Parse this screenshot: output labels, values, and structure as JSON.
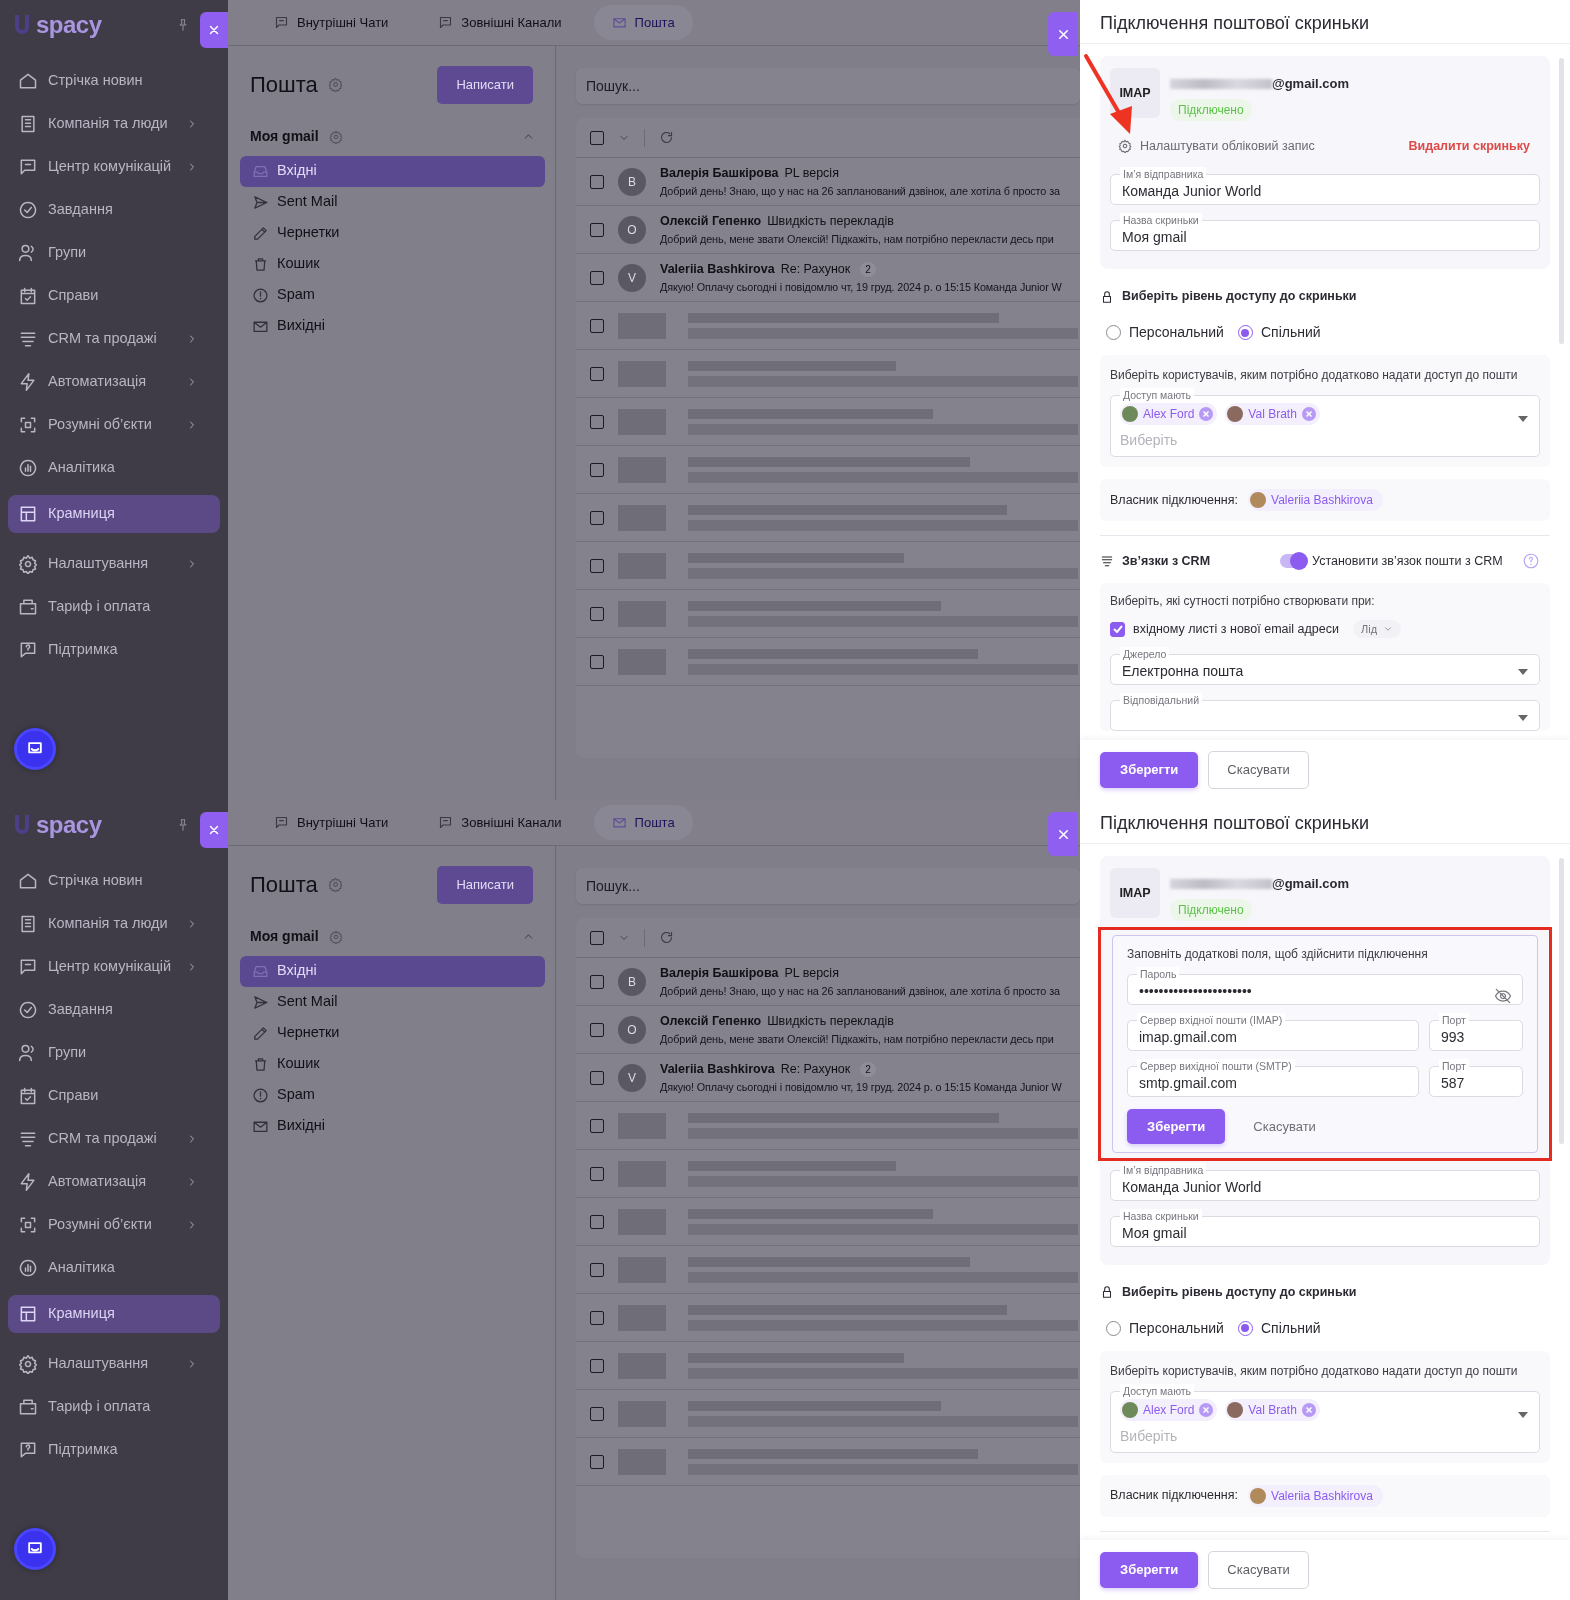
{
  "screens": [
    {
      "sidebar": {
        "logo": "spacy",
        "items": [
          {
            "label": "Стрічка новин",
            "submenu": false,
            "selected": false
          },
          {
            "label": "Компанія та люди",
            "submenu": true,
            "selected": false
          },
          {
            "label": "Центр комунікацій",
            "submenu": true,
            "selected": false
          },
          {
            "label": "Завдання",
            "submenu": false,
            "selected": false
          },
          {
            "label": "Групи",
            "submenu": false,
            "selected": false
          },
          {
            "label": "Справи",
            "submenu": false,
            "selected": false
          },
          {
            "label": "CRM та продажі",
            "submenu": true,
            "selected": false
          },
          {
            "label": "Автоматизація",
            "submenu": true,
            "selected": false
          },
          {
            "label": "Розумні об’єкти",
            "submenu": true,
            "selected": false
          },
          {
            "label": "Аналітика",
            "submenu": false,
            "selected": false
          },
          {
            "label": "Крамниця",
            "submenu": false,
            "selected": true
          },
          {
            "label": "Налаштування",
            "submenu": true,
            "selected": false
          },
          {
            "label": "Тариф і оплата",
            "submenu": false,
            "selected": false
          },
          {
            "label": "Підтримка",
            "submenu": false,
            "selected": false
          }
        ]
      },
      "tabs": [
        {
          "label": "Внутрішні Чати",
          "selected": false
        },
        {
          "label": "Зовнішні Канали",
          "selected": false
        },
        {
          "label": "Пошта",
          "selected": true
        }
      ],
      "mail": {
        "title": "Пошта",
        "compose": "Написати",
        "account": {
          "name": "Моя gmail",
          "expanded": true
        },
        "folders": [
          {
            "label": "Вхідні",
            "selected": true
          },
          {
            "label": "Sent Mail",
            "selected": false
          },
          {
            "label": "Чернетки",
            "selected": false
          },
          {
            "label": "Кошик",
            "selected": false
          },
          {
            "label": "Spam",
            "selected": false
          },
          {
            "label": "Вихідні",
            "selected": false
          }
        ],
        "search": {
          "placeholder": "Пошук..."
        },
        "select_all": {
          "checked": false
        },
        "messages": [
          {
            "kind": "message",
            "checked": false,
            "avatar": "В",
            "sender": "Валерія Башкірова",
            "subject": "PL версія",
            "preview": "Добрий день! Знаю, що у нас на 26 запланований дзвінок, але хотіла б просто за"
          },
          {
            "kind": "message",
            "checked": false,
            "avatar": "О",
            "sender": "Олексій Гепенко",
            "subject": "Швидкість перекладів",
            "preview": "Добрий день, мене звати Олексій! Підкажіть, нам потрібно перекласти десь при"
          },
          {
            "kind": "message",
            "checked": false,
            "avatar": "V",
            "sender": "Valeriia Bashkirova",
            "subject": "Re: Рахунок",
            "count": "2",
            "preview": "Дякую! Оплачу сьогодні і повідомлю чт, 19 груд. 2024 р. о 15:15 Команда Junior W"
          },
          {
            "kind": "blurred",
            "checked": false
          },
          {
            "kind": "blurred",
            "checked": false
          },
          {
            "kind": "blurred",
            "checked": false
          },
          {
            "kind": "blurred",
            "checked": false
          },
          {
            "kind": "blurred",
            "checked": false
          },
          {
            "kind": "blurred",
            "checked": false
          },
          {
            "kind": "blurred",
            "checked": false
          },
          {
            "kind": "blurred",
            "checked": false
          }
        ]
      },
      "panel": {
        "title": "Підключення поштової скриньки",
        "arrow": true,
        "account": {
          "protocol": "IMAP",
          "email": "@gmail.com",
          "status": "Підключено",
          "settings_link": "Налаштувати обліковий запис",
          "delete_link": "Видалити скриньку"
        },
        "fields": [
          {
            "label": "Ім’я відправника",
            "value": "Команда Junior World"
          },
          {
            "label": "Назва скриньки",
            "value": "Моя gmail"
          }
        ],
        "access": {
          "title": "Виберіть рівень доступу до скриньки",
          "options": [
            {
              "label": "Персональний",
              "selected": false
            },
            {
              "label": "Спільний",
              "selected": true
            }
          ]
        },
        "users": {
          "hint": "Виберіть користувачів, яким потрібно додатково надати доступ до пошти",
          "label": "Доступ мають",
          "chips": [
            "Alex Ford",
            "Val Brath"
          ],
          "placeholder": "Виберіть"
        },
        "owner": {
          "label": "Власник підключення:",
          "name": "Valeriia Bashkirova"
        },
        "crm": {
          "title": "Зв’язки з CRM",
          "toggle": {
            "label": "Установити зв’язок пошти з CRM",
            "on": true
          },
          "hint": "Виберіть, які сутності потрібно створювати при:",
          "rule": {
            "label": "вхідному листі з нової email адреси",
            "checked": true,
            "entity": "Лід"
          },
          "fields": [
            {
              "label": "Джерело",
              "value": "Електронна пошта"
            },
            {
              "label": "Відповідальний"
            }
          ]
        },
        "footer": {
          "save": "Зберегти",
          "cancel": "Скасувати"
        }
      }
    },
    {
      "sidebar": {
        "logo": "spacy",
        "items": [
          {
            "label": "Стрічка новин",
            "submenu": false,
            "selected": false
          },
          {
            "label": "Компанія та люди",
            "submenu": true,
            "selected": false
          },
          {
            "label": "Центр комунікацій",
            "submenu": true,
            "selected": false
          },
          {
            "label": "Завдання",
            "submenu": false,
            "selected": false
          },
          {
            "label": "Групи",
            "submenu": false,
            "selected": false
          },
          {
            "label": "Справи",
            "submenu": false,
            "selected": false
          },
          {
            "label": "CRM та продажі",
            "submenu": true,
            "selected": false
          },
          {
            "label": "Автоматизація",
            "submenu": true,
            "selected": false
          },
          {
            "label": "Розумні об’єкти",
            "submenu": true,
            "selected": false
          },
          {
            "label": "Аналітика",
            "submenu": false,
            "selected": false
          },
          {
            "label": "Крамниця",
            "submenu": false,
            "selected": true
          },
          {
            "label": "Налаштування",
            "submenu": true,
            "selected": false
          },
          {
            "label": "Тариф і оплата",
            "submenu": false,
            "selected": false
          },
          {
            "label": "Підтримка",
            "submenu": false,
            "selected": false
          }
        ]
      },
      "tabs": [
        {
          "label": "Внутрішні Чати",
          "selected": false
        },
        {
          "label": "Зовнішні Канали",
          "selected": false
        },
        {
          "label": "Пошта",
          "selected": true
        }
      ],
      "mail": {
        "title": "Пошта",
        "compose": "Написати",
        "account": {
          "name": "Моя gmail",
          "expanded": true
        },
        "folders": [
          {
            "label": "Вхідні",
            "selected": true
          },
          {
            "label": "Sent Mail",
            "selected": false
          },
          {
            "label": "Чернетки",
            "selected": false
          },
          {
            "label": "Кошик",
            "selected": false
          },
          {
            "label": "Spam",
            "selected": false
          },
          {
            "label": "Вихідні",
            "selected": false
          }
        ],
        "search": {
          "placeholder": "Пошук..."
        },
        "select_all": {
          "checked": false
        },
        "messages": [
          {
            "kind": "message",
            "checked": false,
            "avatar": "В",
            "sender": "Валерія Башкірова",
            "subject": "PL версія",
            "preview": "Добрий день! Знаю, що у нас на 26 запланований дзвінок, але хотіла б просто за"
          },
          {
            "kind": "message",
            "checked": false,
            "avatar": "О",
            "sender": "Олексій Гепенко",
            "subject": "Швидкість перекладів",
            "preview": "Добрий день, мене звати Олексій! Підкажіть, нам потрібно перекласти десь при"
          },
          {
            "kind": "message",
            "checked": false,
            "avatar": "V",
            "sender": "Valeriia Bashkirova",
            "subject": "Re: Рахунок",
            "count": "2",
            "preview": "Дякую! Оплачу сьогодні і повідомлю чт, 19 груд. 2024 р. о 15:15 Команда Junior W"
          },
          {
            "kind": "blurred",
            "checked": false
          },
          {
            "kind": "blurred",
            "checked": false
          },
          {
            "kind": "blurred",
            "checked": false
          },
          {
            "kind": "blurred",
            "checked": false
          },
          {
            "kind": "blurred",
            "checked": false
          },
          {
            "kind": "blurred",
            "checked": false
          },
          {
            "kind": "blurred",
            "checked": false
          },
          {
            "kind": "blurred",
            "checked": false
          }
        ]
      },
      "panel": {
        "title": "Підключення поштової скриньки",
        "frame": true,
        "account": {
          "protocol": "IMAP",
          "email": "@gmail.com",
          "status": "Підключено"
        },
        "connect_form": {
          "hint": "Заповніть додаткові поля, щоб здійснити підключення",
          "password": {
            "label": "Пароль",
            "value": "•••••••••••••••••••••••"
          },
          "servers": [
            {
              "label": "Сервер вхідної пошти (IMAP)",
              "value": "imap.gmail.com",
              "port_label": "Порт",
              "port": "993"
            },
            {
              "label": "Сервер вихідної пошти (SMTP)",
              "value": "smtp.gmail.com",
              "port_label": "Порт",
              "port": "587"
            }
          ],
          "save": "Зберегти",
          "cancel": "Скасувати"
        },
        "fields": [
          {
            "label": "Ім’я відправника",
            "value": "Команда Junior World"
          },
          {
            "label": "Назва скриньки",
            "value": "Моя gmail"
          }
        ],
        "access": {
          "title": "Виберіть рівень доступу до скриньки",
          "options": [
            {
              "label": "Персональний",
              "selected": false
            },
            {
              "label": "Спільний",
              "selected": true
            }
          ]
        },
        "users": {
          "hint": "Виберіть користувачів, яким потрібно додатково надати доступ до пошти",
          "label": "Доступ мають",
          "chips": [
            "Alex Ford",
            "Val Brath"
          ],
          "placeholder": "Виберіть"
        },
        "owner": {
          "label": "Власник підключення:",
          "name": "Valeriia Bashkirova"
        },
        "footer": {
          "save": "Зберегти",
          "cancel": "Скасувати"
        }
      }
    }
  ]
}
